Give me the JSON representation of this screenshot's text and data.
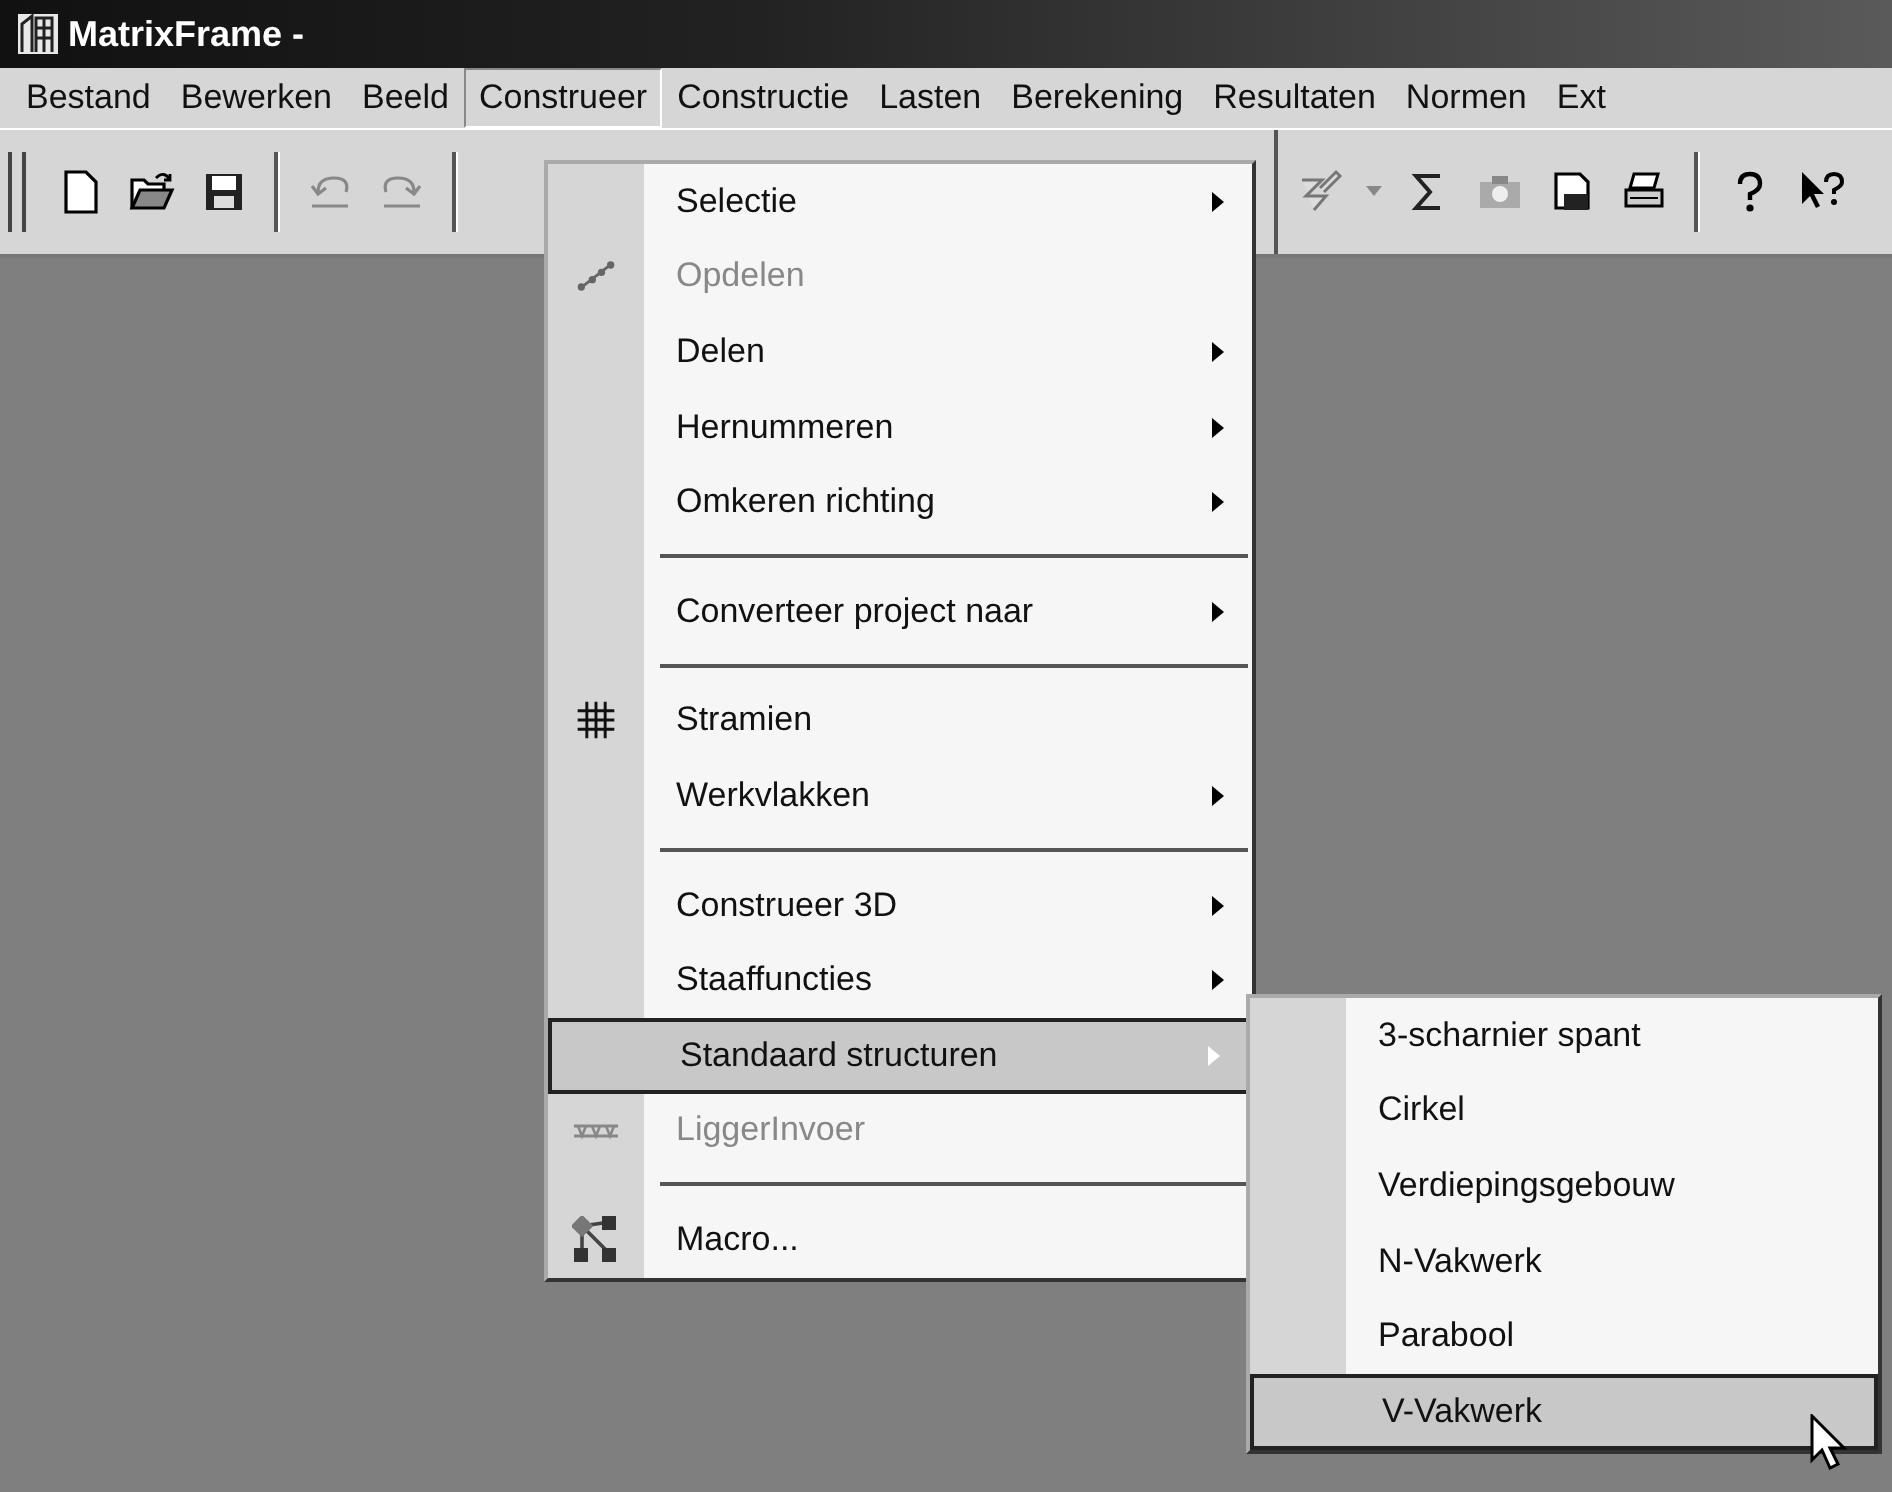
{
  "window": {
    "title": "MatrixFrame -"
  },
  "menubar": [
    {
      "label": "Bestand",
      "selected": false
    },
    {
      "label": "Bewerken",
      "selected": false
    },
    {
      "label": "Beeld",
      "selected": false
    },
    {
      "label": "Construeer",
      "selected": true
    },
    {
      "label": "Constructie",
      "selected": false
    },
    {
      "label": "Lasten",
      "selected": false
    },
    {
      "label": "Berekening",
      "selected": false
    },
    {
      "label": "Resultaten",
      "selected": false
    },
    {
      "label": "Normen",
      "selected": false
    },
    {
      "label": "Ext",
      "selected": false
    }
  ],
  "menu": [
    {
      "kind": "item",
      "label": "Selectie",
      "disabled": false,
      "submenu": true,
      "selected": false
    },
    {
      "kind": "item",
      "label": "Opdelen",
      "disabled": true,
      "submenu": false,
      "selected": false
    },
    {
      "kind": "item",
      "label": "Delen",
      "disabled": false,
      "submenu": true,
      "selected": false
    },
    {
      "kind": "item",
      "label": "Hernummeren",
      "disabled": false,
      "submenu": true,
      "selected": false
    },
    {
      "kind": "item",
      "label": "Omkeren richting",
      "disabled": false,
      "submenu": true,
      "selected": false
    },
    {
      "kind": "separator"
    },
    {
      "kind": "item",
      "label": "Converteer project naar",
      "disabled": false,
      "submenu": true,
      "selected": false
    },
    {
      "kind": "separator"
    },
    {
      "kind": "item",
      "label": "Stramien",
      "disabled": false,
      "submenu": false,
      "selected": false
    },
    {
      "kind": "item",
      "label": "Werkvlakken",
      "disabled": false,
      "submenu": true,
      "selected": false
    },
    {
      "kind": "separator"
    },
    {
      "kind": "item",
      "label": "Construeer 3D",
      "disabled": false,
      "submenu": true,
      "selected": false
    },
    {
      "kind": "item",
      "label": "Staaffuncties",
      "disabled": false,
      "submenu": true,
      "selected": false
    },
    {
      "kind": "item",
      "label": "Standaard structuren",
      "disabled": false,
      "submenu": true,
      "selected": true
    },
    {
      "kind": "item",
      "label": "LiggerInvoer",
      "disabled": true,
      "submenu": false,
      "selected": false
    },
    {
      "kind": "separator"
    },
    {
      "kind": "item",
      "label": "Macro...",
      "disabled": false,
      "submenu": false,
      "selected": false
    }
  ],
  "submenu": [
    {
      "label": "3-scharnier spant",
      "selected": false
    },
    {
      "label": "Cirkel",
      "selected": false
    },
    {
      "label": "Verdiepingsgebouw",
      "selected": false
    },
    {
      "label": "N-Vakwerk",
      "selected": false
    },
    {
      "label": "Parabool",
      "selected": false
    },
    {
      "label": "V-Vakwerk",
      "selected": true
    }
  ]
}
